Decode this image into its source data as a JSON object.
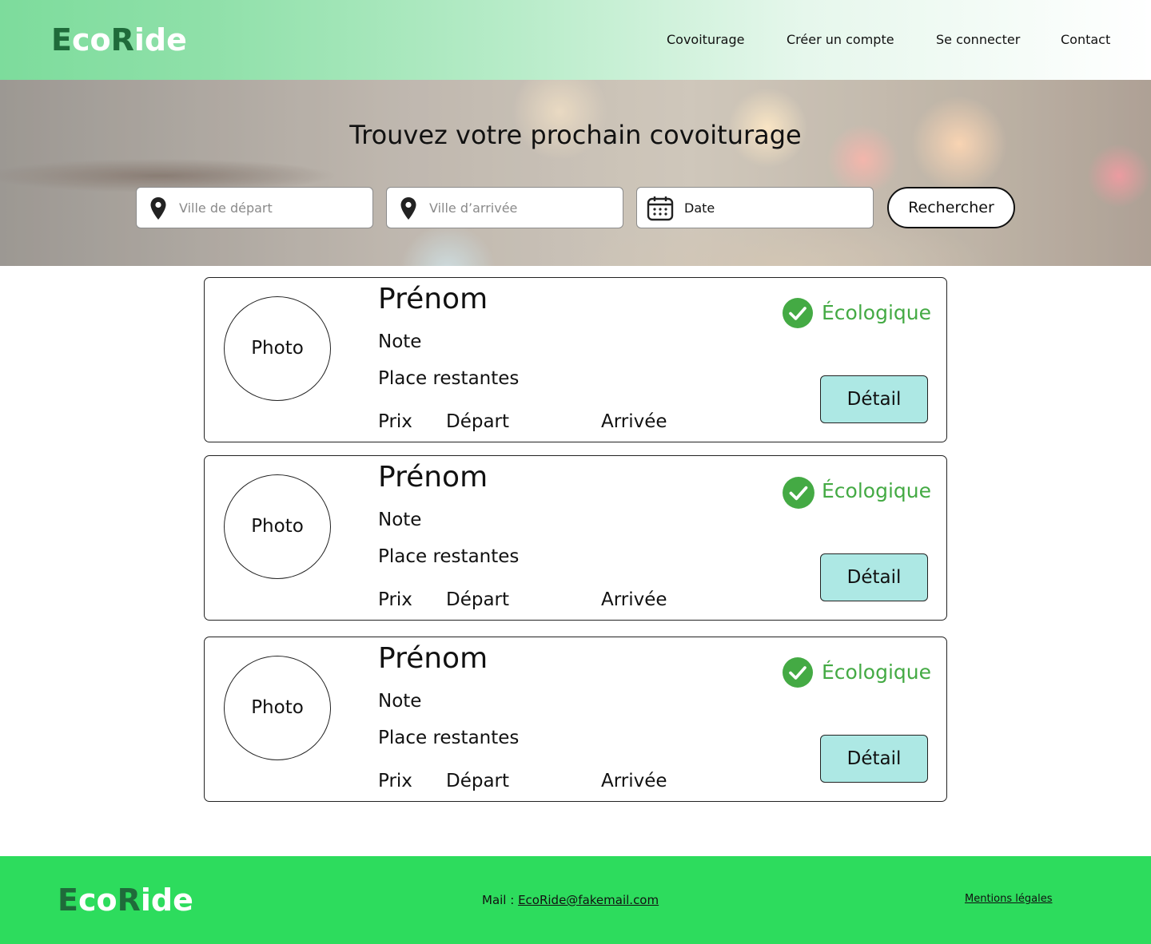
{
  "header": {
    "logo": {
      "part1": "E",
      "part2": "co",
      "part3": "R",
      "part4": "ide"
    },
    "nav": [
      "Covoiturage",
      "Créer un compte",
      "Se connecter",
      "Contact"
    ]
  },
  "hero": {
    "title": "Trouvez votre prochain covoiturage",
    "departure_placeholder": "Ville de départ",
    "arrival_placeholder": "Ville d’arrivée",
    "date_label": "Date",
    "search_label": "Rechercher"
  },
  "cards": [
    {
      "photo": "Photo",
      "firstname": "Prénom",
      "note": "Note",
      "seats": "Place restantes",
      "price": "Prix",
      "departure": "Départ",
      "arrival": "Arrivée",
      "eco_label": "Écologique",
      "detail_label": "Détail"
    },
    {
      "photo": "Photo",
      "firstname": "Prénom",
      "note": "Note",
      "seats": "Place restantes",
      "price": "Prix",
      "departure": "Départ",
      "arrival": "Arrivée",
      "eco_label": "Écologique",
      "detail_label": "Détail"
    },
    {
      "photo": "Photo",
      "firstname": "Prénom",
      "note": "Note",
      "seats": "Place restantes",
      "price": "Prix",
      "departure": "Départ",
      "arrival": "Arrivée",
      "eco_label": "Écologique",
      "detail_label": "Détail"
    }
  ],
  "footer": {
    "logo": {
      "part1": "E",
      "part2": "co",
      "part3": "R",
      "part4": "ide"
    },
    "mail_label": "Mail : ",
    "mail_address": "EcoRide@fakemail.com",
    "legal": "Mentions légales"
  },
  "colors": {
    "eco_green": "#44aa44",
    "detail_button": "#ade8e4",
    "footer_bg": "#2ddc5d",
    "logo_dark": "#1f6b3a"
  }
}
